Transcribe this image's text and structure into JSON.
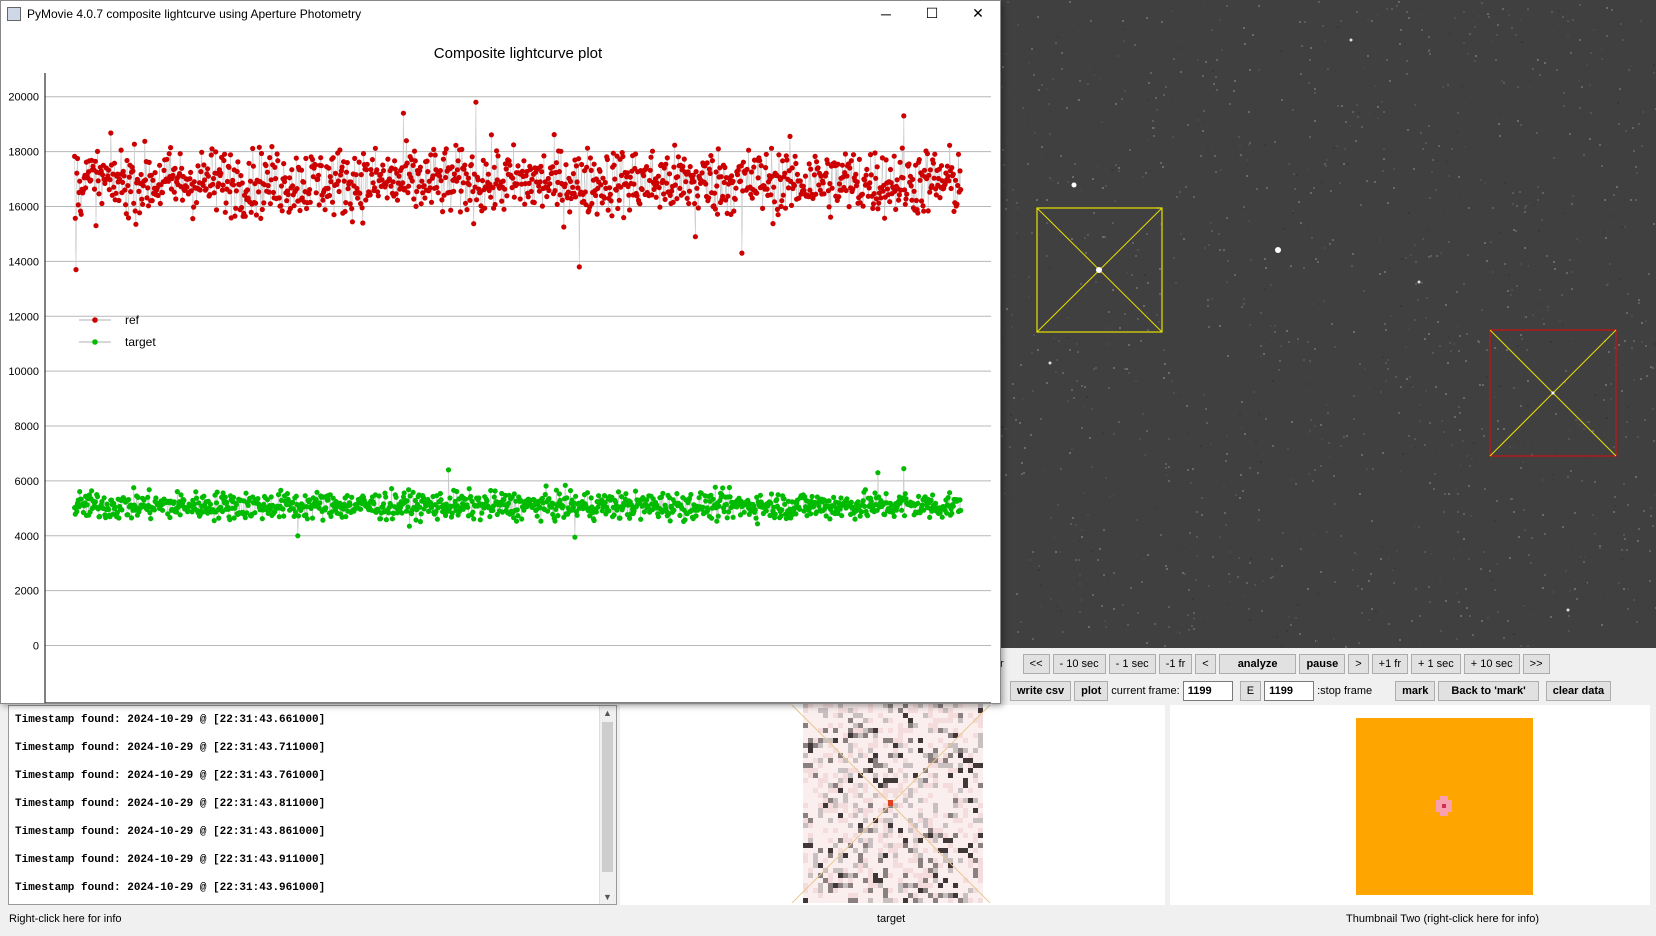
{
  "window": {
    "title": "PyMovie 4.0.7 composite lightcurve using Aperture Photometry",
    "minimize_glyph": "─",
    "maximize_glyph": "☐",
    "close_glyph": "✕"
  },
  "controls": {
    "row1": [
      "<<",
      "- 10 sec",
      "- 1 sec",
      "-1 fr",
      "<",
      "analyze",
      "pause",
      ">",
      "+1 fr",
      "+ 1 sec",
      "+ 10 sec",
      ">>"
    ],
    "write_csv": "write csv",
    "plot": "plot",
    "current_frame_label": "current frame:",
    "current_frame_value": "1199",
    "e_button": "E",
    "stop_frame_value": "1199",
    "stop_frame_label": ":stop frame",
    "mark": "mark",
    "back_to_mark": "Back to 'mark'",
    "clear_data": "clear data"
  },
  "log": {
    "lines": [
      "Timestamp found: 2024-10-29 @ [22:31:43.661000]",
      "Timestamp found: 2024-10-29 @ [22:31:43.711000]",
      "Timestamp found: 2024-10-29 @ [22:31:43.761000]",
      "Timestamp found: 2024-10-29 @ [22:31:43.811000]",
      "Timestamp found: 2024-10-29 @ [22:31:43.861000]",
      "Timestamp found: 2024-10-29 @ [22:31:43.911000]",
      "Timestamp found: 2024-10-29 @ [22:31:43.961000]"
    ]
  },
  "status": {
    "left": "Right-click here for info",
    "middle": "target",
    "right": "Thumbnail Two (right-click here for info)"
  },
  "colors": {
    "ref": "#cc0000",
    "target": "#00bb00",
    "thumbnail_two": "#ffa500"
  },
  "chart_data": {
    "type": "scatter",
    "title": "Composite lightcurve plot",
    "xlabel": "",
    "ylabel": "",
    "xlim": [
      -40,
      1240
    ],
    "ylim": [
      -1000,
      20500
    ],
    "xticks": [
      0,
      200,
      400,
      600,
      800,
      1000,
      1200
    ],
    "yticks": [
      0,
      2000,
      4000,
      6000,
      8000,
      10000,
      12000,
      14000,
      16000,
      18000,
      20000
    ],
    "grid": "horizontal",
    "legend_position": "left",
    "series": [
      {
        "name": "ref",
        "color": "#cc0000",
        "x_start": 0,
        "x_end": 1199,
        "mean": 16900,
        "spread": 1100,
        "sample_points": [
          [
            2,
            13700
          ],
          [
            445,
            19400
          ],
          [
            543,
            19800
          ],
          [
            683,
            13800
          ],
          [
            840,
            14900
          ],
          [
            903,
            14300
          ],
          [
            1122,
            19300
          ]
        ]
      },
      {
        "name": "target",
        "color": "#00bb00",
        "x_start": 0,
        "x_end": 1199,
        "mean": 5100,
        "spread": 450,
        "sample_points": [
          [
            302,
            4000
          ],
          [
            506,
            6400
          ],
          [
            677,
            3950
          ],
          [
            1087,
            6300
          ],
          [
            1122,
            6450
          ]
        ]
      }
    ]
  }
}
